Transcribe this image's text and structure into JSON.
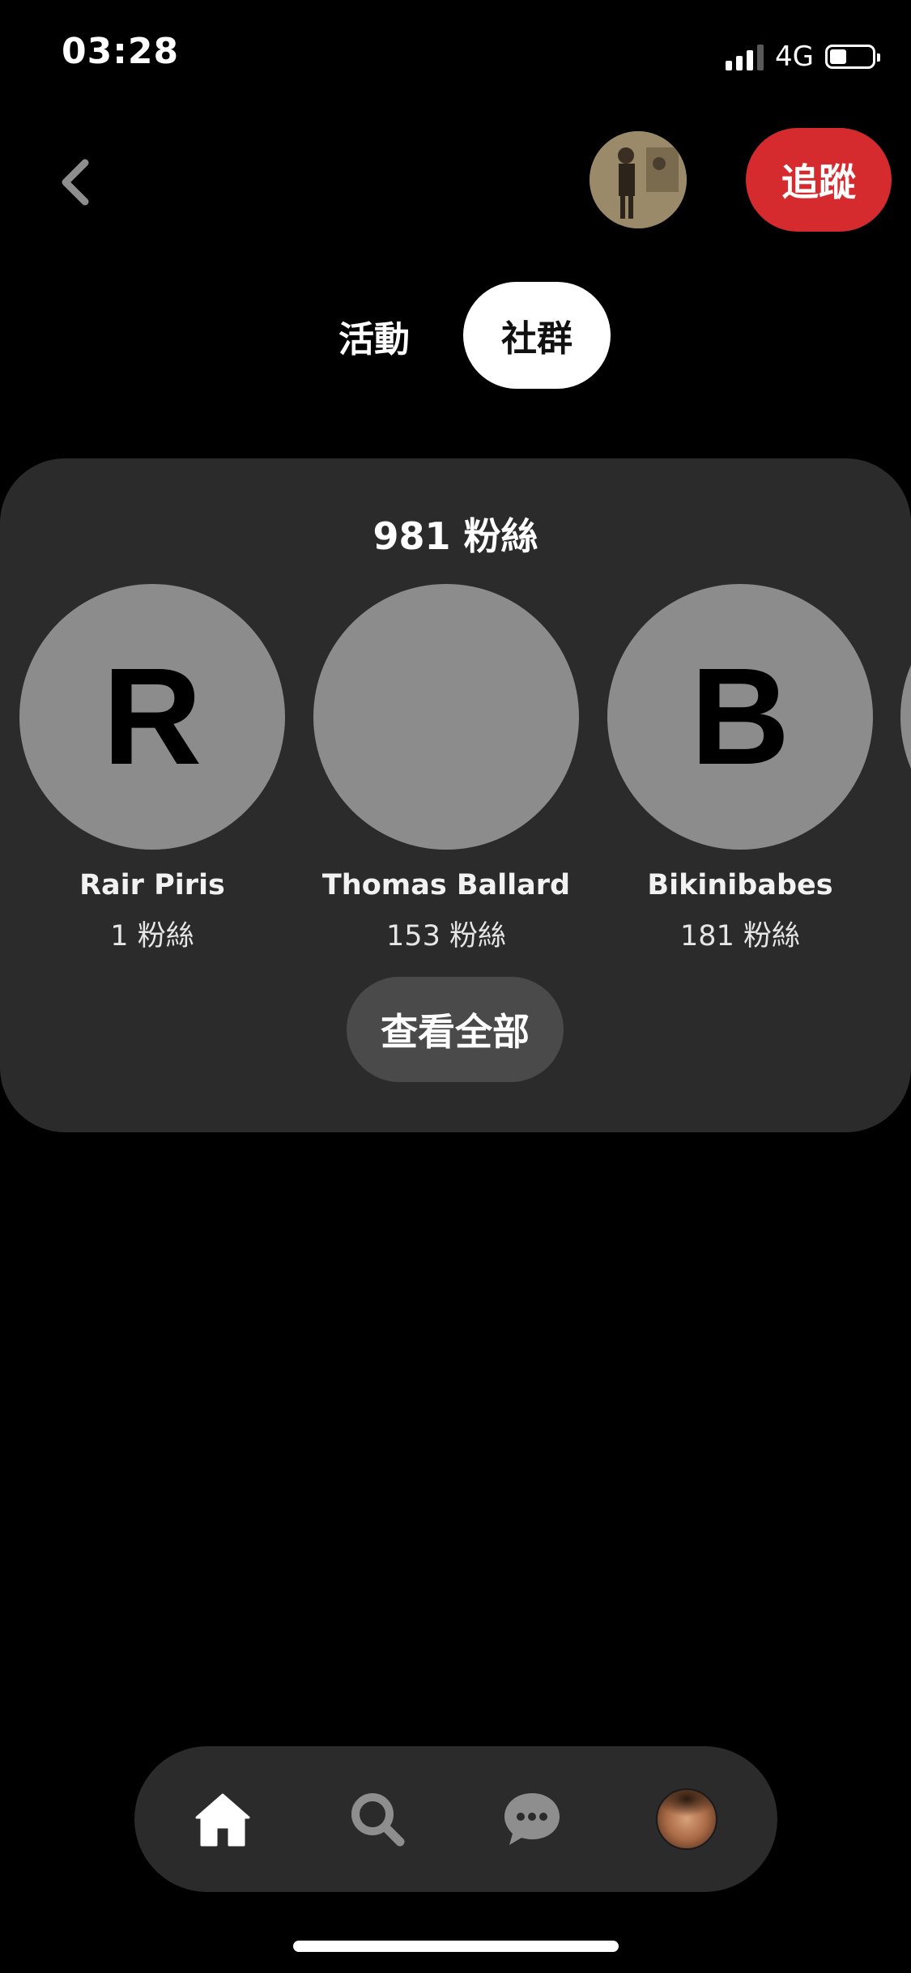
{
  "status_bar": {
    "time": "03:28",
    "network": "4G",
    "battery_level": 0.4
  },
  "header": {
    "back_icon": "chevron-left-icon",
    "follow_label": "追蹤"
  },
  "tabs": [
    {
      "label": "活動",
      "active": false
    },
    {
      "label": "社群",
      "active": true
    }
  ],
  "followers_card": {
    "title": "981 粉絲",
    "followers": [
      {
        "name": "Rair Piris",
        "count": "1 粉絲",
        "initial": "R",
        "avatar": "letter"
      },
      {
        "name": "Thomas Ballard",
        "count": "153 粉絲",
        "initial": "",
        "avatar": "photo"
      },
      {
        "name": "Bikinibabes",
        "count": "181 粉絲",
        "initial": "B",
        "avatar": "letter"
      }
    ],
    "view_all_label": "查看全部"
  },
  "bottom_nav": {
    "items": [
      {
        "icon": "home-icon",
        "active": true
      },
      {
        "icon": "search-icon",
        "active": false
      },
      {
        "icon": "chat-bubble-icon",
        "active": false
      },
      {
        "icon": "profile-avatar-icon",
        "active": false
      }
    ]
  },
  "colors": {
    "background": "#000000",
    "card": "#2b2b2b",
    "accent_red": "#d62b2e",
    "placeholder_avatar": "#8c8c8c"
  }
}
